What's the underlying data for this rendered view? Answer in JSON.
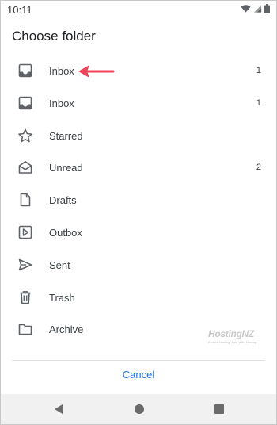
{
  "status_bar": {
    "time": "10:11"
  },
  "dialog": {
    "title": "Choose folder",
    "folders": [
      {
        "label": "Inbox",
        "count": "1",
        "icon": "inbox-icon"
      },
      {
        "label": "Inbox",
        "count": "1",
        "icon": "inbox-icon"
      },
      {
        "label": "Starred",
        "count": "",
        "icon": "star-icon"
      },
      {
        "label": "Unread",
        "count": "2",
        "icon": "open-envelope-icon"
      },
      {
        "label": "Drafts",
        "count": "",
        "icon": "document-icon"
      },
      {
        "label": "Outbox",
        "count": "",
        "icon": "outbox-icon"
      },
      {
        "label": "Sent",
        "count": "",
        "icon": "send-icon"
      },
      {
        "label": "Trash",
        "count": "",
        "icon": "trash-icon"
      },
      {
        "label": "Archive",
        "count": "",
        "icon": "folder-icon"
      }
    ],
    "cancel_label": "Cancel"
  },
  "watermark": {
    "main": "HostingNZ",
    "sub": "Secure Hosting, Fast Web Hosting"
  },
  "colors": {
    "accent": "#1a73e8",
    "annotation_arrow": "#f0435a",
    "icon": "#5f6368"
  }
}
